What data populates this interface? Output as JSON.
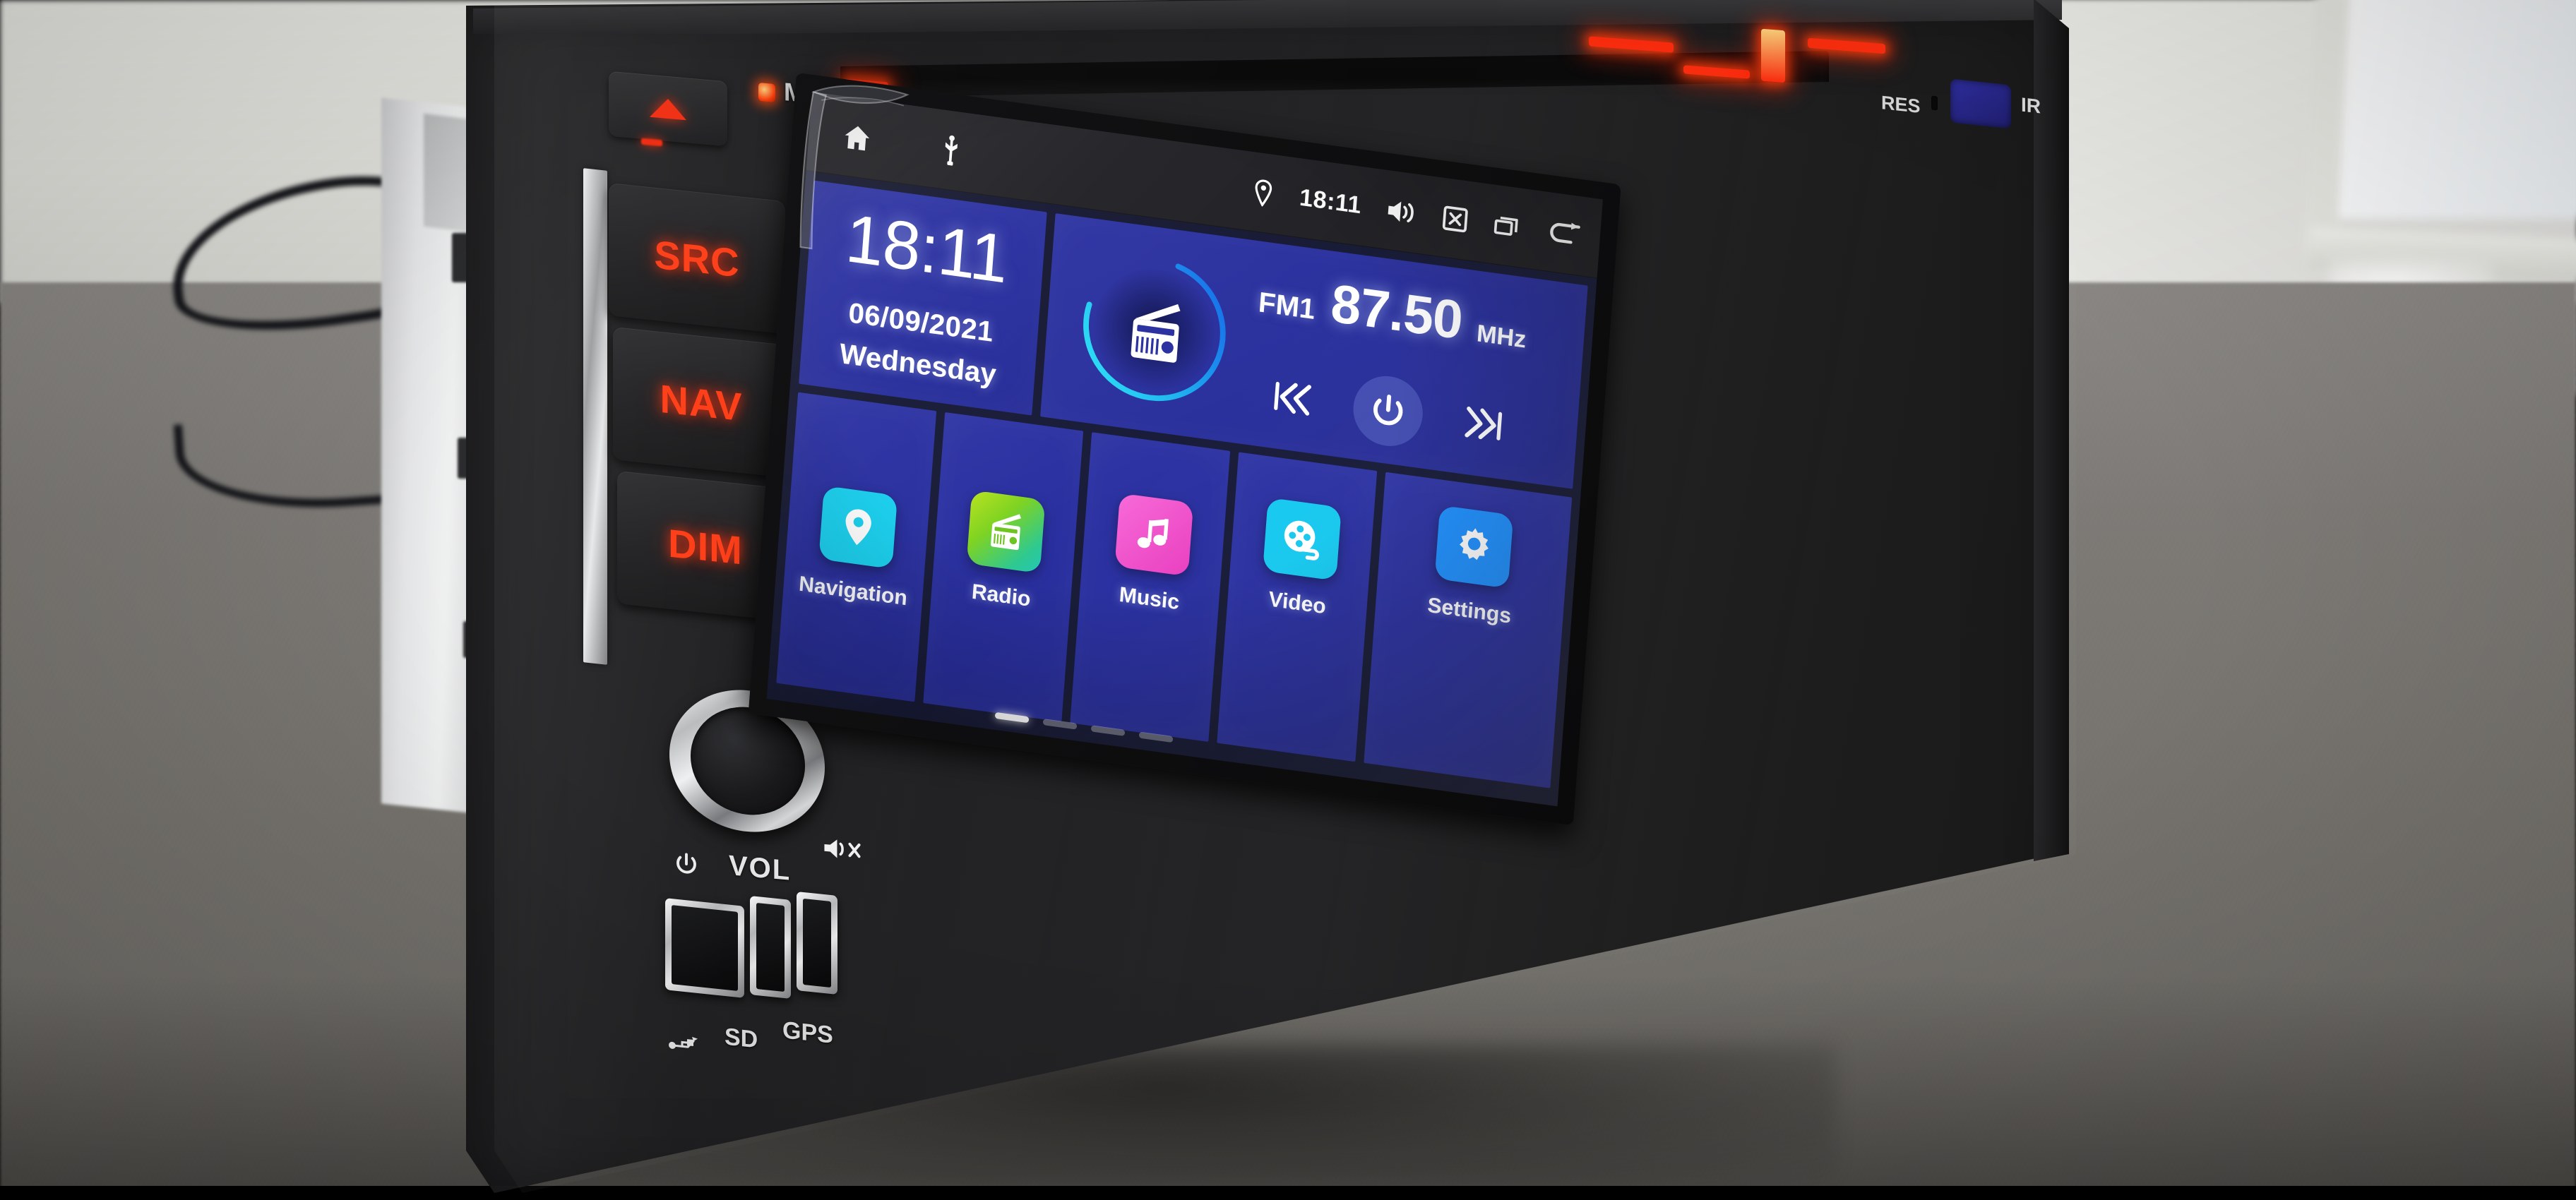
{
  "device": {
    "type": "car-stereo-head-unit",
    "physical_buttons": [
      {
        "name": "eject",
        "label": "",
        "icon": "eject-triangle-icon",
        "color": "#fb2d10"
      },
      {
        "name": "src",
        "label": "SRC",
        "color": "#fd3b14"
      },
      {
        "name": "nav",
        "label": "NAV",
        "color": "#fd3b14"
      },
      {
        "name": "dim",
        "label": "DIM",
        "color": "#fd3b14"
      }
    ],
    "mic_label": "MIC",
    "res_label": "RES",
    "ir_label": "IR",
    "vol_label": "VOL",
    "sd_label": "SD",
    "gps_label": "GPS",
    "usb_icon": "usb-icon",
    "power_icon": "power-icon",
    "mute_icon": "mute-speaker-icon",
    "knob": "volume-knob"
  },
  "statusbar": {
    "left_icons": [
      "home-icon",
      "usb-icon"
    ],
    "location_icon": "location-pin-icon",
    "time": "18:11",
    "right_icons": [
      "volume-icon",
      "close-box-icon",
      "recents-icon",
      "back-icon"
    ]
  },
  "clock_widget": {
    "time": "18:11",
    "date": "06/09/2021",
    "weekday": "Wednesday"
  },
  "radio_widget": {
    "icon": "radio-icon",
    "band": "FM1",
    "frequency": "87.50",
    "unit": "MHz",
    "prev_icon": "skip-previous-icon",
    "power_icon": "power-icon",
    "next_icon": "skip-next-icon",
    "dial_color": "#1ec8f0",
    "dial_progress_pct": 72
  },
  "apps": [
    {
      "label": "Navigation",
      "icon": "location-pin-icon",
      "color": "#1ad0ef"
    },
    {
      "label": "Radio",
      "icon": "radio-icon",
      "color": "#7ed321"
    },
    {
      "label": "Music",
      "icon": "music-note-icon",
      "color": "#f04bd0"
    },
    {
      "label": "Video",
      "icon": "film-reel-icon",
      "color": "#17c8ef"
    },
    {
      "label": "Settings",
      "icon": "gear-icon",
      "color": "#1e90ff"
    }
  ],
  "page_indicator": {
    "count": 4,
    "active": 1
  },
  "theme": {
    "screen_bg": "#1a1d3a",
    "tile_blue": "#2e34a2",
    "statusbar_bg": "#232327",
    "accent_red": "#fd3b14"
  }
}
